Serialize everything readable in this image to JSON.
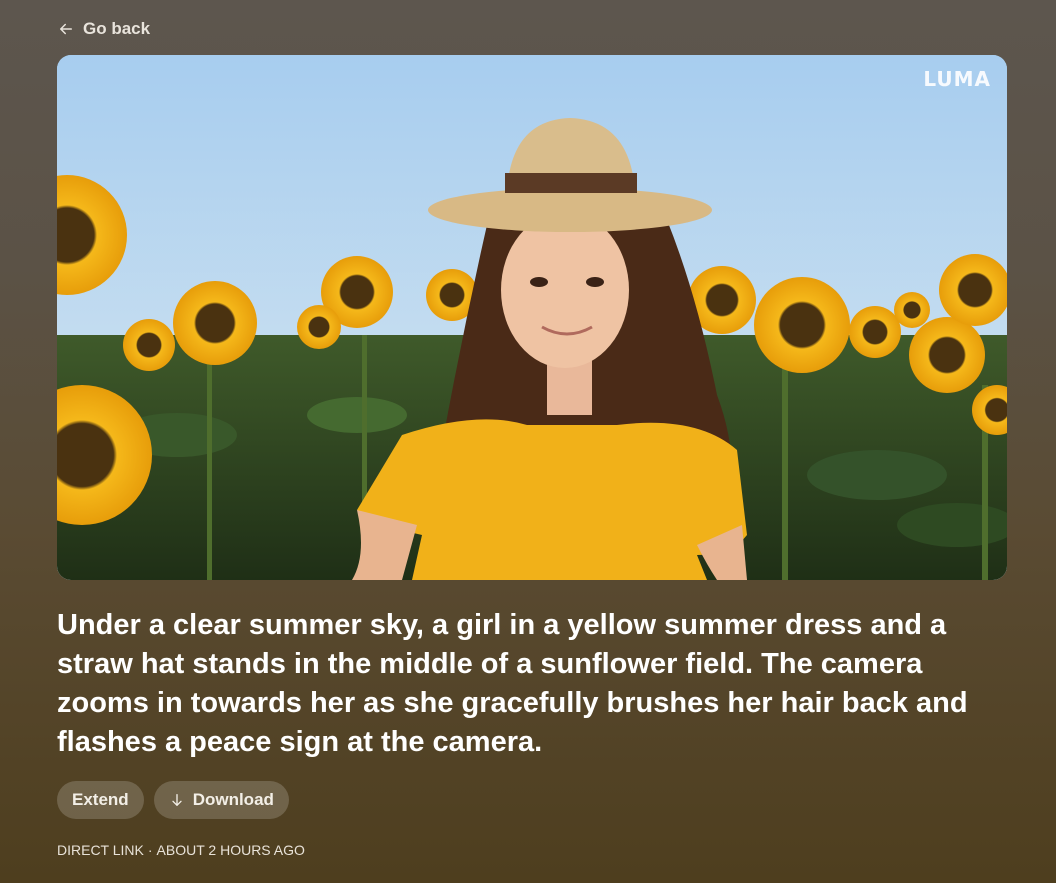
{
  "nav": {
    "back_label": "Go back",
    "back_icon": "arrow-left-icon"
  },
  "video": {
    "watermark": "LUMA"
  },
  "prompt": "Under a clear summer sky, a girl in a yellow summer dress and a straw hat stands in the middle of a sunflower field. The camera zooms in towards her as she gracefully brushes her hair back and flashes a peace sign at the camera.",
  "actions": {
    "extend_label": "Extend",
    "download_label": "Download",
    "download_icon": "arrow-down-icon"
  },
  "meta": {
    "link_label": "DIRECT LINK",
    "separator": "·",
    "time": "ABOUT 2 HOURS AGO"
  }
}
